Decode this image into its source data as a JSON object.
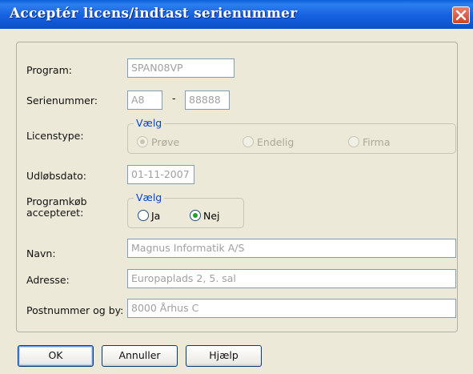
{
  "window": {
    "title": "Acceptér licens/indtast serienummer"
  },
  "form": {
    "program": {
      "label": "Program:",
      "value": "SPAN08VP"
    },
    "serial": {
      "label": "Serienummer:",
      "part1": "A8",
      "separator": "-",
      "part2": "88888"
    },
    "licensetype": {
      "label": "Licenstype:",
      "legend": "Vælg",
      "options": [
        "Prøve",
        "Endelig",
        "Firma"
      ],
      "selected": "Prøve",
      "disabled": true
    },
    "expiry": {
      "label": "Udløbsdato:",
      "value": "01-11-2007"
    },
    "purchase": {
      "label_line1": "Programkøb",
      "label_line2": "accepteret:",
      "legend": "Vælg",
      "options": [
        "Ja",
        "Nej"
      ],
      "selected": "Nej"
    },
    "name": {
      "label": "Navn:",
      "value": "Magnus Informatik A/S"
    },
    "address": {
      "label": "Adresse:",
      "value": "Europaplads 2, 5. sal"
    },
    "postal": {
      "label": "Postnummer og by:",
      "value": "8000 Århus C"
    }
  },
  "buttons": {
    "ok": "OK",
    "cancel": "Annuller",
    "help": "Hjælp"
  },
  "colors": {
    "title_bar": "#0A5FD8",
    "legend_text": "#0046D5",
    "dialog_bg": "#ECE9D8",
    "radio_dot": "#21A121"
  }
}
